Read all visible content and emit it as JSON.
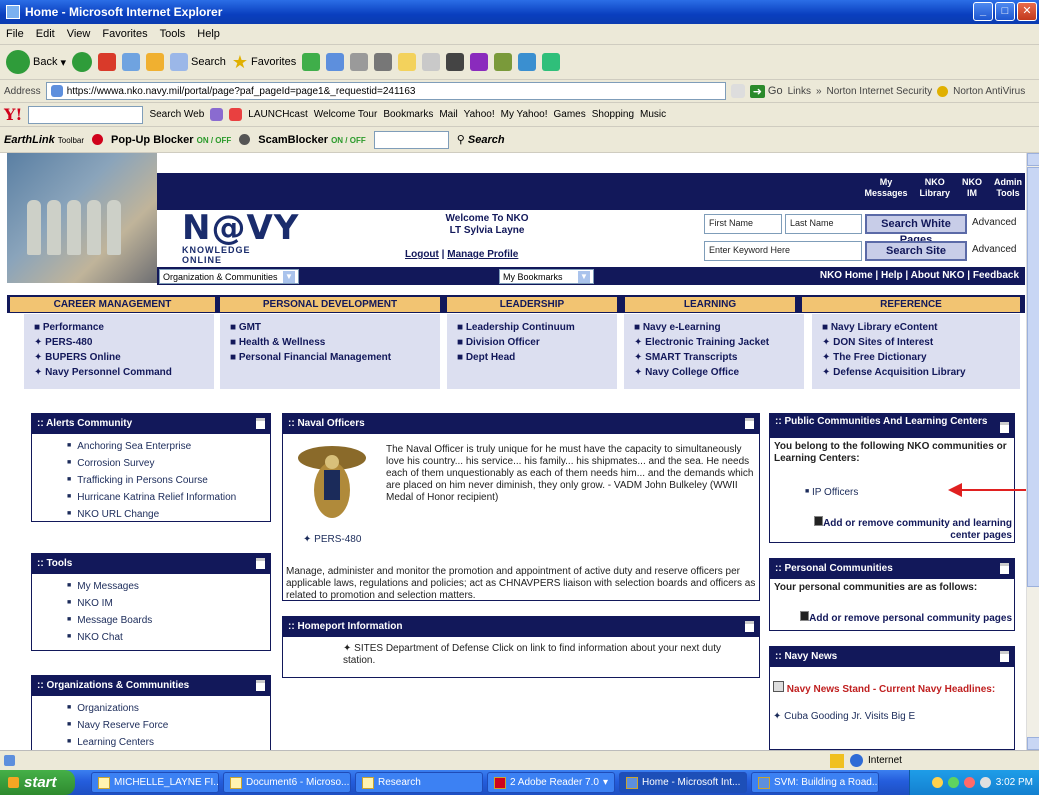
{
  "window": {
    "title": "Home - Microsoft Internet Explorer"
  },
  "menu": [
    "File",
    "Edit",
    "View",
    "Favorites",
    "Tools",
    "Help"
  ],
  "toolbar": {
    "back": "Back",
    "search": "Search",
    "favorites": "Favorites"
  },
  "address": {
    "label": "Address",
    "url": "https://wwwa.nko.navy.mil/portal/page?paf_pageId=page1&_requestid=241163",
    "go": "Go",
    "links": "Links",
    "norton_security": "Norton Internet Security",
    "norton_antivirus": "Norton AntiVirus"
  },
  "yahoo": {
    "search_web": "Search Web",
    "launchcast": "LAUNCHcast",
    "welcome_tour": "Welcome Tour",
    "bookmarks": "Bookmarks",
    "mail": "Mail",
    "yahoo": "Yahoo!",
    "my_yahoo": "My Yahoo!",
    "games": "Games",
    "shopping": "Shopping",
    "music": "Music"
  },
  "earthlink": {
    "logo": "EarthLink",
    "logo_sub": "Toolbar",
    "popup_blocker": "Pop-Up Blocker",
    "scam_blocker": "ScamBlocker",
    "state": "ON / OFF",
    "search": "Search"
  },
  "header": {
    "top_links": [
      "My\nMessages",
      "NKO\nLibrary",
      "NKO\nIM",
      "Admin\nTools"
    ],
    "logo_main": "N@VY",
    "logo_sub": "KNOWLEDGE ONLINE",
    "welcome": "Welcome To NKO",
    "user": "LT Sylvia Layne",
    "logout": "Logout",
    "manage_profile": "Manage Profile",
    "first_name": "First Name",
    "last_name": "Last Name",
    "search_white_pages": "Search White Pages",
    "advanced": "Advanced",
    "keyword_placeholder": "Enter Keyword Here",
    "search_site": "Search Site",
    "org_select": "Organization & Communities",
    "bookmarks_select": "My Bookmarks",
    "nav_links": "NKO Home  |  Help  |  About NKO  |  Feedback"
  },
  "tabs": [
    "CAREER MANAGEMENT",
    "PERSONAL DEVELOPMENT",
    "LEADERSHIP",
    "LEARNING",
    "REFERENCE"
  ],
  "categories": [
    [
      "■ Performance",
      "✦ PERS-480",
      "✦ BUPERS Online",
      "✦ Navy Personnel Command"
    ],
    [
      "■ GMT",
      "■ Health & Wellness",
      "■ Personal Financial Management"
    ],
    [
      "■ Leadership Continuum",
      "■ Division Officer",
      "■ Dept Head"
    ],
    [
      "■ Navy e-Learning",
      "✦ Electronic Training Jacket",
      "✦ SMART Transcripts",
      "✦ Navy College Office"
    ],
    [
      "■ Navy Library eContent",
      "✦ DON Sites of Interest",
      "✦ The Free Dictionary",
      "✦ Defense Acquisition Library"
    ]
  ],
  "alerts": {
    "title": ":: Alerts Community",
    "items": [
      "Anchoring Sea Enterprise",
      "Corrosion Survey",
      "Trafficking in Persons Course",
      "Hurricane Katrina Relief Information",
      "NKO URL Change"
    ]
  },
  "tools": {
    "title": ":: Tools",
    "items": [
      "My Messages",
      "NKO IM",
      "Message Boards",
      "NKO Chat"
    ]
  },
  "orgs": {
    "title": ":: Organizations & Communities",
    "items": [
      "Organizations",
      "Navy Reserve Force",
      "Learning Centers"
    ]
  },
  "naval_officers": {
    "title": ":: Naval Officers",
    "quote": "The Naval Officer is truly unique for he must have the capacity to simultaneously love his country... his service... his family... his shipmates... and the sea. He needs each of them unquestionably as each of them needs him... and the demands which are placed on him never diminish, they only grow. - VADM John Bulkeley (WWII Medal of Honor recipient)",
    "pers_link": "✦ PERS-480",
    "description": "Manage, administer and monitor the promotion and appointment of active duty and reserve officers per applicable laws, regulations and policies; act as CHNAVPERS liaison with selection boards and officers as related to promotion and selection matters."
  },
  "homeport": {
    "title": ":: Homeport Information",
    "text": "✦ SITES Department of Defense  Click on link to find information about your next duty station."
  },
  "public_comm": {
    "title": ":: Public Communities And Learning Centers",
    "intro": "You belong to the following NKO communities or Learning Centers:",
    "item": "IP Officers",
    "add": "Add or remove community and learning center pages"
  },
  "personal_comm": {
    "title": ":: Personal Communities",
    "intro": "Your personal communities are as follows:",
    "add": "Add or remove personal community pages"
  },
  "navy_news": {
    "title": ":: Navy News",
    "headline": "Navy News Stand - Current Navy Headlines:",
    "item": "Cuba Gooding Jr. Visits Big E"
  },
  "status": {
    "zone": "Internet"
  },
  "taskbar": {
    "start": "start",
    "tasks": [
      "MICHELLE_LAYNE FI...",
      "Document6 - Microso...",
      "Research",
      "2 Adobe Reader 7.0",
      "Home - Microsoft Int...",
      "SVM: Building a Road..."
    ],
    "clock": "3:02 PM"
  },
  "colors": {
    "navy": "#12185a",
    "tab": "#f2c472",
    "cat_bg": "#dcdff0",
    "arrow": "#e02020"
  }
}
